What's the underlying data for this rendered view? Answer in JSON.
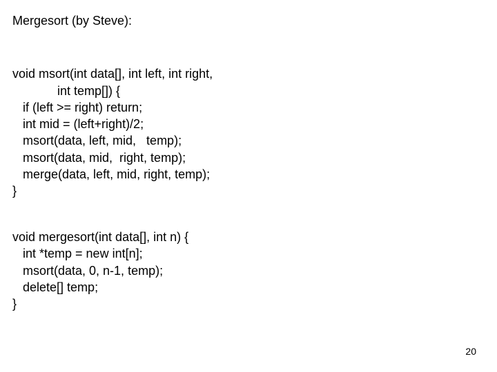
{
  "title": "Mergesort (by Steve):",
  "code1_line1": "void msort(int data[], int left, int right,",
  "code1_line2": "             int temp[]) {",
  "code1_line3": "   if (left >= right) return;",
  "code1_line4": "   int mid = (left+right)/2;",
  "code1_line5": "   msort(data, left, mid,   temp);",
  "code1_line6": "   msort(data, mid,  right, temp);",
  "code1_line7": "   merge(data, left, mid, right, temp);",
  "code1_line8": "}",
  "code2_line1": "void mergesort(int data[], int n) {",
  "code2_line2": "   int *temp = new int[n];",
  "code2_line3": "   msort(data, 0, n-1, temp);",
  "code2_line4": "   delete[] temp;",
  "code2_line5": "}",
  "page_number": "20"
}
